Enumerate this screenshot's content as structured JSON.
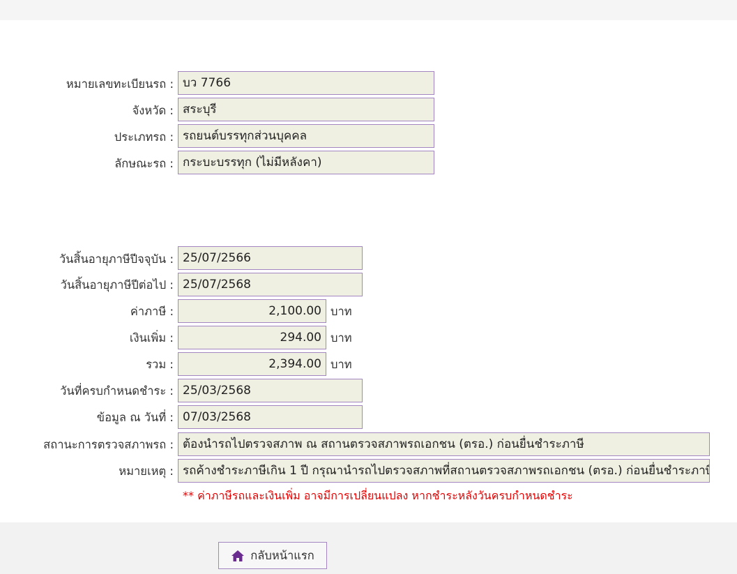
{
  "vehicle": {
    "plate_label": "หมายเลขทะเบียนรถ :",
    "plate_value": "บว 7766",
    "province_label": "จังหวัด :",
    "province_value": "สระบุรี",
    "type_label": "ประเภทรถ :",
    "type_value": "รถยนต์บรรทุกส่วนบุคคล",
    "body_label": "ลักษณะรถ :",
    "body_value": "กระบะบรรทุก (ไม่มีหลังคา)"
  },
  "tax": {
    "current_expiry_label": "วันสิ้นอายุภาษีปีจจุบัน :",
    "current_expiry_value": "25/07/2566",
    "next_expiry_label": "วันสิ้นอายุภาษีปีต่อไป :",
    "next_expiry_value": "25/07/2568",
    "fee_label": "ค่าภาษี :",
    "fee_value": "2,100.00",
    "surcharge_label": "เงินเพิ่ม :",
    "surcharge_value": "294.00",
    "total_label": "รวม :",
    "total_value": "2,394.00",
    "currency_unit": "บาท",
    "due_date_label": "วันที่ครบกำหนดชำระ :",
    "due_date_value": "25/03/2568",
    "data_date_label": "ข้อมูล ณ วันที่ :",
    "data_date_value": "07/03/2568",
    "inspection_label": "สถานะการตรวจสภาพรถ :",
    "inspection_value": "ต้องนำรถไปตรวจสภาพ ณ สถานตรวจสภาพรถเอกชน (ตรอ.) ก่อนยื่นชำระภาษี",
    "remark_label": "หมายเหตุ :",
    "remark_value": "รถค้างชำระภาษีเกิน 1 ปี กรุณานำรถไปตรวจสภาพที่สถานตรวจสภาพรถเอกชน (ตรอ.) ก่อนยื่นชำระภาษี",
    "warning_note": "** ค่าภาษีรถและเงินเพิ่ม อาจมีการเปลี่ยนแปลง หากชำระหลังวันครบกำหนดชำระ"
  },
  "actions": {
    "home_label": "กลับหน้าแรก",
    "home_icon": "home-icon"
  },
  "colors": {
    "field_border": "#a385c1",
    "field_background": "#efefe2",
    "warning_text": "#e60000",
    "icon": "#6b2c8f"
  }
}
